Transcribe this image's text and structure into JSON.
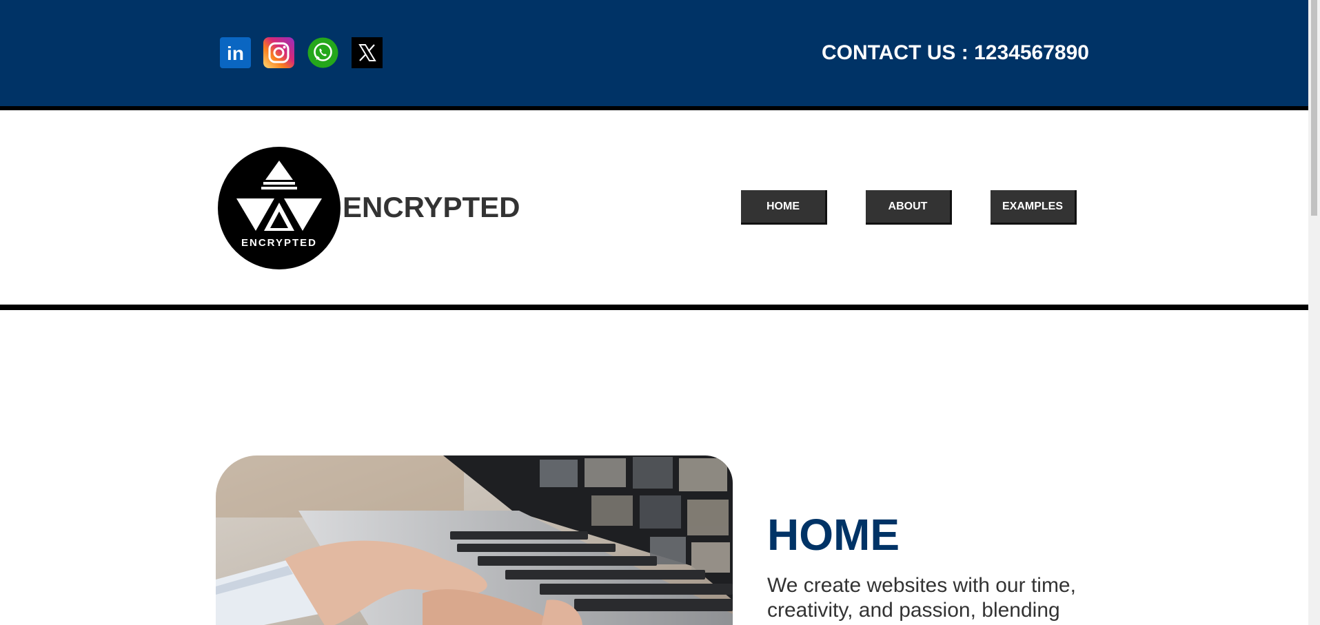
{
  "topbar": {
    "background": "#003366",
    "social_icons": [
      {
        "name": "linkedin-icon",
        "color": "#0a66c2",
        "glyph": "in"
      },
      {
        "name": "instagram-icon",
        "color": "#e1306c"
      },
      {
        "name": "whatsapp-icon",
        "color": "#25a71b"
      },
      {
        "name": "x-icon",
        "color": "#000000",
        "glyph": "X"
      }
    ],
    "contact": "CONTACT US : 1234567890"
  },
  "header": {
    "logo_text": "ENCRYPTED",
    "brand": "ENCRYPTED",
    "nav": [
      {
        "label": "HOME"
      },
      {
        "label": "ABOUT"
      },
      {
        "label": "EXAMPLES"
      }
    ]
  },
  "hero": {
    "image": "laptop-typing-photo",
    "title": "HOME",
    "text": "We create websites with our time, creativity, and passion, blending"
  },
  "colors": {
    "primary": "#003366",
    "button": "#333333",
    "text": "#333333"
  }
}
